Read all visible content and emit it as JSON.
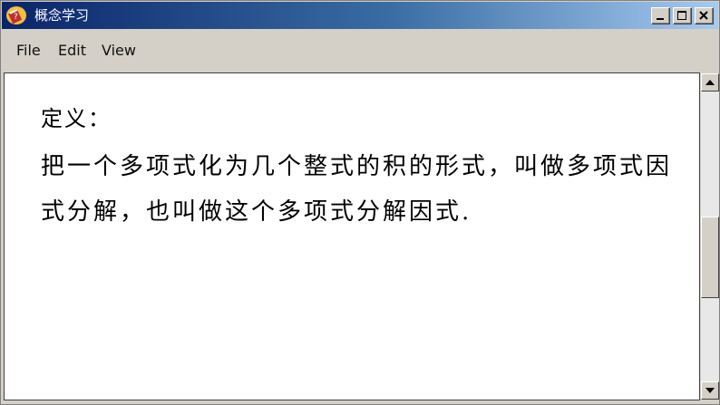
{
  "window": {
    "title": "概念学习"
  },
  "menu": {
    "items": [
      "File",
      "Edit",
      "View"
    ]
  },
  "content": {
    "heading": "定义：",
    "paragraph": "把一个多项式化为几个整式的积的形式，叫做多项式因式分解，也叫做这个多项式分解因式."
  },
  "icons": {
    "app": "book-icon",
    "minimize": "minimize-icon",
    "maximize": "maximize-icon",
    "close": "close-icon",
    "scroll_up": "triangle-up-icon",
    "scroll_down": "triangle-down-icon"
  },
  "colors": {
    "titlebar_start": "#0a246a",
    "titlebar_end": "#a6caf0",
    "window_face": "#d4d0c8"
  }
}
